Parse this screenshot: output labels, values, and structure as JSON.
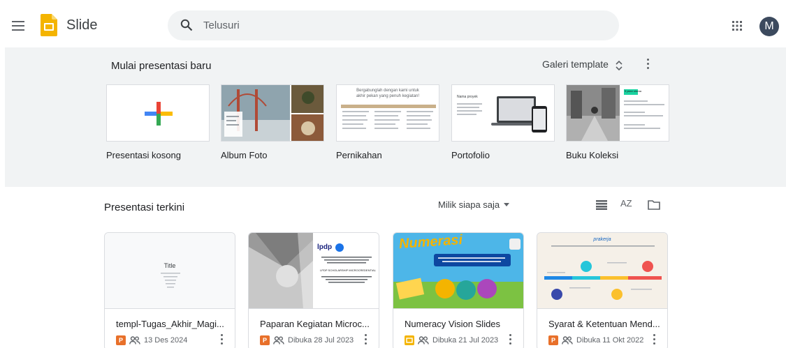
{
  "header": {
    "app_title": "Slide",
    "search_placeholder": "Telusuri",
    "avatar_initial": "M"
  },
  "gallery": {
    "title": "Mulai presentasi baru",
    "gallery_link": "Galeri template",
    "templates": [
      {
        "label": "Presentasi kosong"
      },
      {
        "label": "Album Foto"
      },
      {
        "label": "Pernikahan",
        "heading": "Bergabunglah dengan kami untuk akhir pekan yang penuh kegiatan!"
      },
      {
        "label": "Portofolio",
        "heading": "Nama proyek"
      },
      {
        "label": "Buku Koleksi",
        "heading": "5 jalan utama"
      }
    ]
  },
  "recent": {
    "title": "Presentasi terkini",
    "owner_filter": "Milik siapa saja",
    "sort_label": "AZ",
    "files": [
      {
        "title": "templ-Tugas_Akhir_Magi...",
        "date": "13 Des 2024",
        "type": "P",
        "type_color": "#e8702a",
        "thumb_title": "Title"
      },
      {
        "title": "Paparan Kegiatan Microc...",
        "date": "Dibuka 28 Jul 2023",
        "type": "P",
        "type_color": "#e8702a",
        "thumb_brand": "lpdp",
        "thumb_heading": "LPDP SCHOLARSHIP MICROCREDENTIAL"
      },
      {
        "title": "Numeracy Vision Slides",
        "date": "Dibuka 21 Jul 2023",
        "type": "slides",
        "type_color": "#f4b400",
        "thumb_heading": "Numerasi"
      },
      {
        "title": "Syarat & Ketentuan Mend...",
        "date": "Dibuka 11 Okt 2022",
        "type": "P",
        "type_color": "#e8702a",
        "thumb_brand": "prakerja"
      }
    ]
  },
  "colors": {
    "accent": "#1a73e8",
    "slides_yellow": "#f4b400",
    "gallery_bg": "#f1f3f4"
  }
}
